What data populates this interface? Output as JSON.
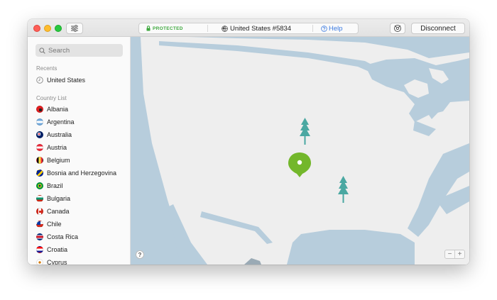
{
  "toolbar": {
    "status": "PROTECTED",
    "server": "United States #5834",
    "help": "Help",
    "disconnect": "Disconnect"
  },
  "sidebar": {
    "search_placeholder": "Search",
    "recents_label": "Recents",
    "recents": [
      {
        "label": "United States"
      }
    ],
    "country_list_label": "Country List",
    "countries": [
      {
        "label": "Albania",
        "flag": "albania-flag"
      },
      {
        "label": "Argentina",
        "flag": "argentina-flag"
      },
      {
        "label": "Australia",
        "flag": "australia-flag"
      },
      {
        "label": "Austria",
        "flag": "austria-flag"
      },
      {
        "label": "Belgium",
        "flag": "belgium-flag"
      },
      {
        "label": "Bosnia and Herzegovina",
        "flag": "bosnia-flag"
      },
      {
        "label": "Brazil",
        "flag": "brazil-flag"
      },
      {
        "label": "Bulgaria",
        "flag": "bulgaria-flag"
      },
      {
        "label": "Canada",
        "flag": "canada-flag"
      },
      {
        "label": "Chile",
        "flag": "chile-flag"
      },
      {
        "label": "Costa Rica",
        "flag": "costa-rica-flag"
      },
      {
        "label": "Croatia",
        "flag": "croatia-flag"
      },
      {
        "label": "Cyprus",
        "flag": "cyprus-flag"
      }
    ]
  },
  "map": {
    "help_button": "?",
    "zoom_out": "−",
    "zoom_in": "+",
    "water_color": "#b7cddc",
    "land_color": "#eeeeee",
    "pin_color": "#73b72b",
    "tree_color": "#4aa8a2"
  }
}
